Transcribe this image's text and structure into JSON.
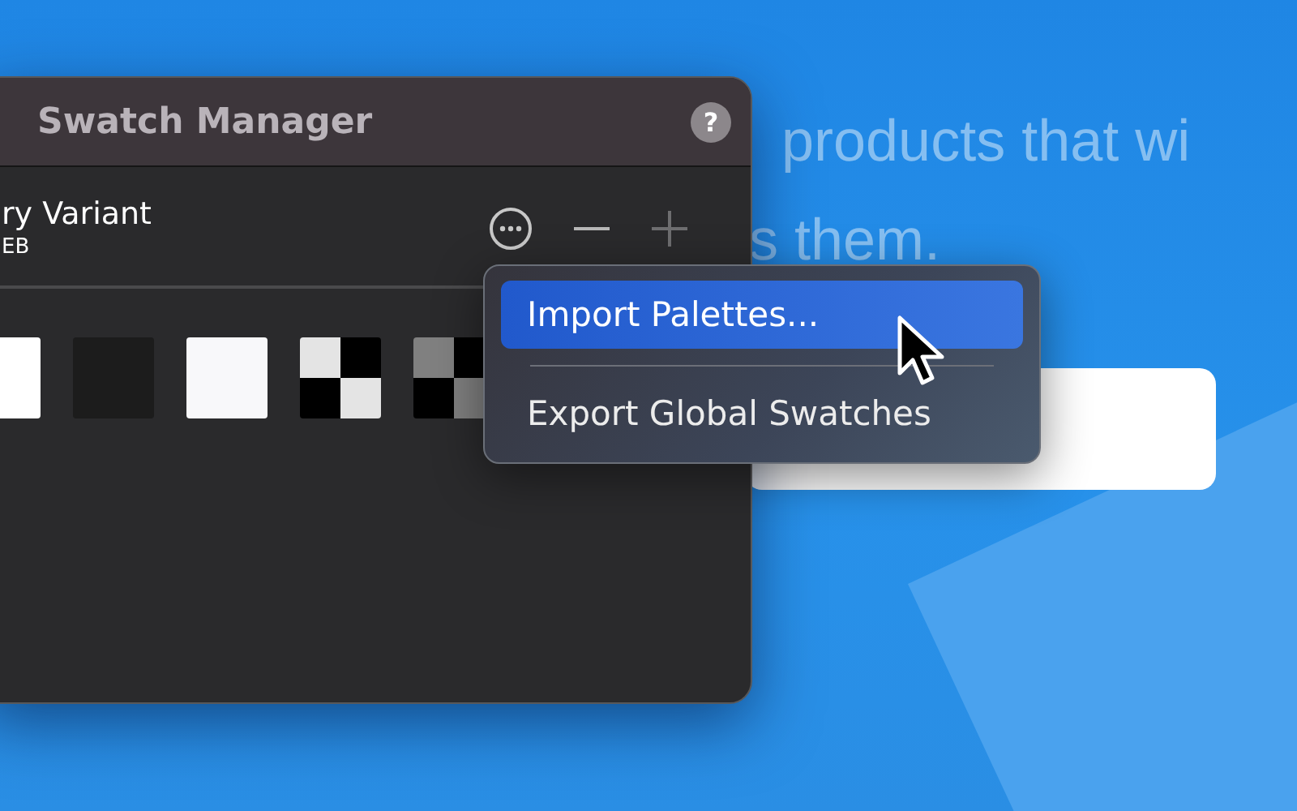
{
  "background": {
    "lines": [
      "products that wi",
      "s them."
    ]
  },
  "window": {
    "title": "Swatch Manager",
    "help": "?"
  },
  "swatch_header": {
    "name": "ry Variant",
    "subtitle": "EB"
  },
  "swatches": [
    {
      "kind": "solid",
      "color": "#ffffff"
    },
    {
      "kind": "solid",
      "color": "#1c1c1c"
    },
    {
      "kind": "solid",
      "color": "#f8f8fa"
    },
    {
      "kind": "checker",
      "color": "#e4e4e4"
    },
    {
      "kind": "checker",
      "color": "#808080"
    }
  ],
  "menu": {
    "items": [
      {
        "label": "Import Palettes...",
        "selected": true
      },
      {
        "label": "Export Global Swatches",
        "selected": false
      }
    ]
  }
}
